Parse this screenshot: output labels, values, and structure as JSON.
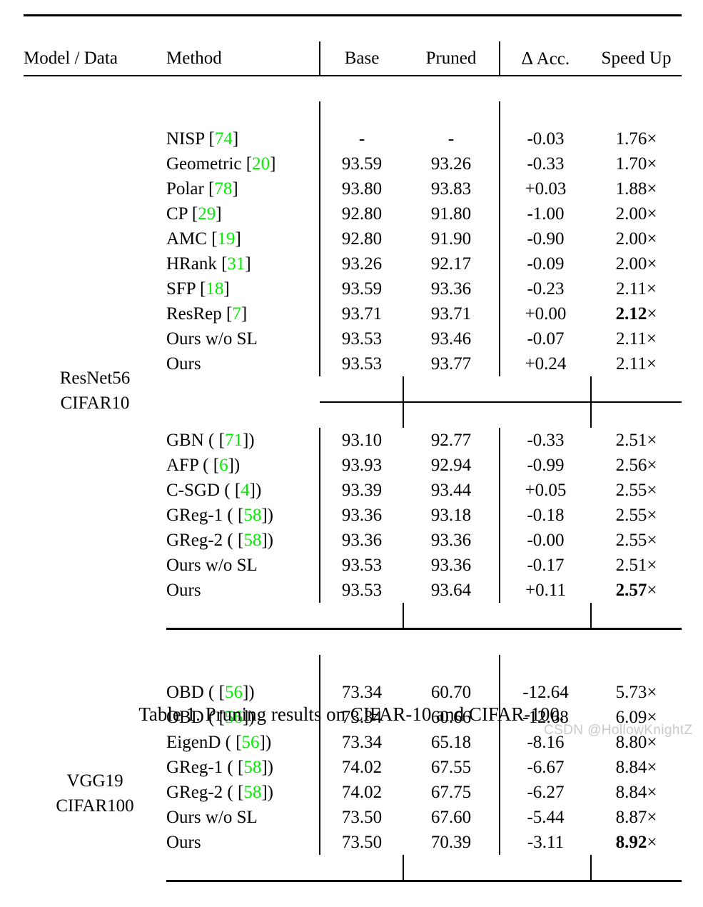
{
  "table": {
    "columns": [
      "Model / Data",
      "Method",
      "Base",
      "Pruned",
      "Δ Acc.",
      "Speed Up"
    ],
    "header": {
      "model_data": "Model / Data",
      "method": "Method",
      "base": "Base",
      "pruned": "Pruned",
      "delta_symbol": "∆",
      "delta_acc": "Acc.",
      "speed_up": "Speed Up"
    },
    "groups": [
      {
        "group_label_line1": "ResNet56",
        "group_label_line2": "CIFAR10",
        "blocks": [
          {
            "rows": [
              {
                "method_text": "NISP [",
                "cite": "74",
                "method_tail": "]",
                "base": "-",
                "pruned": "-",
                "acc": "-0.03",
                "speed": "1.76",
                "speed_suffix": "×",
                "bold": {
                  "method": false,
                  "base": false,
                  "pruned": false,
                  "acc": false,
                  "speed": false
                }
              },
              {
                "method_text": "Geometric [",
                "cite": "20",
                "method_tail": "]",
                "base": "93.59",
                "pruned": "93.26",
                "acc": "-0.33",
                "speed": "1.70",
                "speed_suffix": "×",
                "bold": {
                  "method": false,
                  "base": false,
                  "pruned": false,
                  "acc": false,
                  "speed": false
                }
              },
              {
                "method_text": "Polar [",
                "cite": "78",
                "method_tail": "]",
                "base": "93.80",
                "pruned": "93.83",
                "acc": "+0.03",
                "speed": "1.88",
                "speed_suffix": "×",
                "bold": {
                  "method": false,
                  "base": false,
                  "pruned": false,
                  "acc": false,
                  "speed": false
                }
              },
              {
                "method_text": "CP [",
                "cite": "29",
                "method_tail": "]",
                "base": "92.80",
                "pruned": "91.80",
                "acc": "-1.00",
                "speed": "2.00",
                "speed_suffix": "×",
                "bold": {
                  "method": false,
                  "base": false,
                  "pruned": false,
                  "acc": false,
                  "speed": false
                }
              },
              {
                "method_text": "AMC [",
                "cite": "19",
                "method_tail": "]",
                "base": "92.80",
                "pruned": "91.90",
                "acc": "-0.90",
                "speed": "2.00",
                "speed_suffix": "×",
                "bold": {
                  "method": false,
                  "base": false,
                  "pruned": false,
                  "acc": false,
                  "speed": false
                }
              },
              {
                "method_text": "HRank [",
                "cite": "31",
                "method_tail": "]",
                "base": "93.26",
                "pruned": "92.17",
                "acc": "-0.09",
                "speed": "2.00",
                "speed_suffix": "×",
                "bold": {
                  "method": false,
                  "base": false,
                  "pruned": false,
                  "acc": false,
                  "speed": false
                }
              },
              {
                "method_text": "SFP [",
                "cite": "18",
                "method_tail": "]",
                "base": "93.59",
                "pruned": "93.36",
                "acc": "-0.23",
                "speed": "2.11",
                "speed_suffix": "×",
                "bold": {
                  "method": false,
                  "base": false,
                  "pruned": false,
                  "acc": false,
                  "speed": false
                }
              },
              {
                "method_text": "ResRep [",
                "cite": "7",
                "method_tail": "]",
                "base": "93.71",
                "pruned": "93.71",
                "acc": "+0.00",
                "speed": "2.12",
                "speed_suffix": "×",
                "bold": {
                  "method": false,
                  "base": false,
                  "pruned": false,
                  "acc": false,
                  "speed": true
                }
              },
              {
                "method_text": "Ours w/o SL",
                "cite": "",
                "method_tail": "",
                "base": "93.53",
                "pruned": "93.46",
                "acc": "-0.07",
                "speed": "2.11",
                "speed_suffix": "×",
                "bold": {
                  "method": false,
                  "base": false,
                  "pruned": false,
                  "acc": false,
                  "speed": false
                }
              },
              {
                "method_text": "Ours",
                "cite": "",
                "method_tail": "",
                "base": "93.53",
                "pruned": "93.77",
                "acc": "+0.24",
                "speed": "2.11",
                "speed_suffix": "×",
                "bold": {
                  "method": true,
                  "base": false,
                  "pruned": true,
                  "acc": true,
                  "speed": false
                }
              }
            ]
          },
          {
            "rows": [
              {
                "method_text": "GBN ( [",
                "cite": "71",
                "method_tail": "])",
                "base": "93.10",
                "pruned": "92.77",
                "acc": "-0.33",
                "speed": "2.51",
                "speed_suffix": "×",
                "bold": {
                  "method": false,
                  "base": false,
                  "pruned": false,
                  "acc": false,
                  "speed": false
                }
              },
              {
                "method_text": "AFP ( [",
                "cite": "6",
                "method_tail": "])",
                "base": "93.93",
                "pruned": "92.94",
                "acc": "-0.99",
                "speed": "2.56",
                "speed_suffix": "×",
                "bold": {
                  "method": false,
                  "base": false,
                  "pruned": false,
                  "acc": false,
                  "speed": false
                }
              },
              {
                "method_text": "C-SGD ( [",
                "cite": "4",
                "method_tail": "])",
                "base": "93.39",
                "pruned": "93.44",
                "acc": "+0.05",
                "speed": "2.55",
                "speed_suffix": "×",
                "bold": {
                  "method": false,
                  "base": false,
                  "pruned": false,
                  "acc": false,
                  "speed": false
                }
              },
              {
                "method_text": "GReg-1 ( [",
                "cite": "58",
                "method_tail": "])",
                "base": "93.36",
                "pruned": "93.18",
                "acc": "-0.18",
                "speed": "2.55",
                "speed_suffix": "×",
                "bold": {
                  "method": false,
                  "base": false,
                  "pruned": false,
                  "acc": false,
                  "speed": false
                }
              },
              {
                "method_text": "GReg-2 ( [",
                "cite": "58",
                "method_tail": "])",
                "base": "93.36",
                "pruned": "93.36",
                "acc": "-0.00",
                "speed": "2.55",
                "speed_suffix": "×",
                "bold": {
                  "method": false,
                  "base": false,
                  "pruned": false,
                  "acc": false,
                  "speed": false
                }
              },
              {
                "method_text": "Ours w/o SL",
                "cite": "",
                "method_tail": "",
                "base": "93.53",
                "pruned": "93.36",
                "acc": "-0.17",
                "speed": "2.51",
                "speed_suffix": "×",
                "bold": {
                  "method": false,
                  "base": false,
                  "pruned": false,
                  "acc": false,
                  "speed": false
                }
              },
              {
                "method_text": "Ours",
                "cite": "",
                "method_tail": "",
                "base": "93.53",
                "pruned": "93.64",
                "acc": "+0.11",
                "speed": "2.57",
                "speed_suffix": "×",
                "bold": {
                  "method": true,
                  "base": false,
                  "pruned": true,
                  "acc": true,
                  "speed": true
                }
              }
            ]
          }
        ]
      },
      {
        "group_label_line1": "VGG19",
        "group_label_line2": "CIFAR100",
        "blocks": [
          {
            "rows": [
              {
                "method_text": "OBD ( [",
                "cite": "56",
                "method_tail": "])",
                "base": "73.34",
                "pruned": "60.70",
                "acc": "-12.64",
                "speed": "5.73",
                "speed_suffix": "×",
                "bold": {
                  "method": false,
                  "base": false,
                  "pruned": false,
                  "acc": false,
                  "speed": false
                }
              },
              {
                "method_text": "OBD ( [",
                "cite": "56",
                "method_tail": "])",
                "base": "73.34",
                "pruned": "60.66",
                "acc": "-12.68",
                "speed": "6.09",
                "speed_suffix": "×",
                "bold": {
                  "method": false,
                  "base": false,
                  "pruned": false,
                  "acc": false,
                  "speed": false
                }
              },
              {
                "method_text": "EigenD ( [",
                "cite": "56",
                "method_tail": "])",
                "base": "73.34",
                "pruned": "65.18",
                "acc": "-8.16",
                "speed": "8.80",
                "speed_suffix": "×",
                "bold": {
                  "method": false,
                  "base": false,
                  "pruned": false,
                  "acc": false,
                  "speed": false
                }
              },
              {
                "method_text": "GReg-1 ( [",
                "cite": "58",
                "method_tail": "])",
                "base": "74.02",
                "pruned": "67.55",
                "acc": "-6.67",
                "speed": "8.84",
                "speed_suffix": "×",
                "bold": {
                  "method": false,
                  "base": false,
                  "pruned": false,
                  "acc": false,
                  "speed": false
                }
              },
              {
                "method_text": "GReg-2 ( [",
                "cite": "58",
                "method_tail": "])",
                "base": "74.02",
                "pruned": "67.75",
                "acc": "-6.27",
                "speed": "8.84",
                "speed_suffix": "×",
                "bold": {
                  "method": false,
                  "base": false,
                  "pruned": false,
                  "acc": false,
                  "speed": false
                }
              },
              {
                "method_text": "Ours w/o SL",
                "cite": "",
                "method_tail": "",
                "base": "73.50",
                "pruned": "67.60",
                "acc": "-5.44",
                "speed": "8.87",
                "speed_suffix": "×",
                "bold": {
                  "method": false,
                  "base": false,
                  "pruned": false,
                  "acc": false,
                  "speed": false
                }
              },
              {
                "method_text": "Ours",
                "cite": "",
                "method_tail": "",
                "base": "73.50",
                "pruned": "70.39",
                "acc": "-3.11",
                "speed": "8.92",
                "speed_suffix": "×",
                "bold": {
                  "method": true,
                  "base": false,
                  "pruned": true,
                  "acc": true,
                  "speed": true
                }
              }
            ]
          }
        ]
      }
    ]
  },
  "caption": "Table 1. Pruning results on CIFAR-10 and CIFAR-100.",
  "watermark": "CSDN @HollowKnightZ",
  "colors": {
    "citation_green": "#00ee00",
    "rule_black": "#000000",
    "watermark_gray": "#c9c9c9"
  }
}
